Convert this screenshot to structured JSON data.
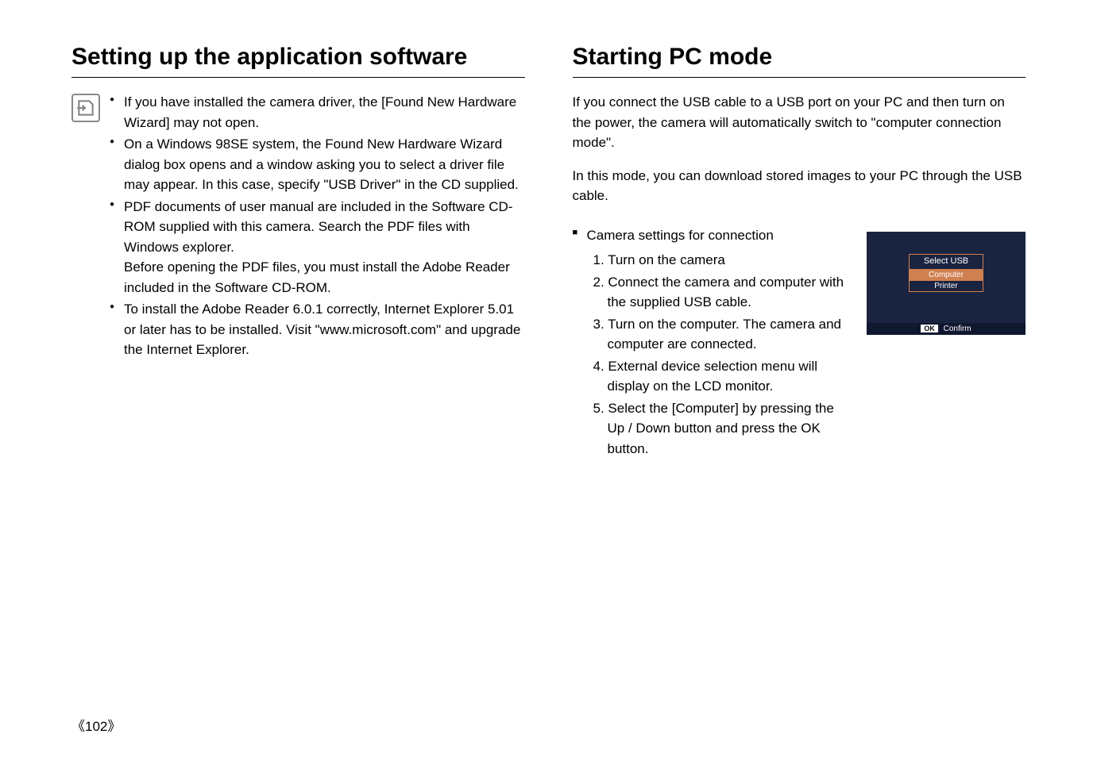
{
  "left": {
    "title": "Setting up the application software",
    "bullets": [
      {
        "text": "If you have installed the camera driver, the [Found New Hardware Wizard] may not open."
      },
      {
        "text": "On a Windows 98SE system, the Found New Hardware Wizard dialog box opens and a window asking you to select a driver file may appear. In this case, specify \"USB Driver\" in the CD supplied."
      },
      {
        "text": "PDF documents of user manual are included in the Software CD-ROM supplied with this camera. Search the PDF files with Windows explorer.",
        "subtext": "Before opening the PDF files, you must install the Adobe Reader included in the Software CD-ROM."
      },
      {
        "text": "To install the Adobe Reader 6.0.1 correctly, Internet Explorer 5.01 or later has to be installed. Visit \"www.microsoft.com\" and upgrade the Internet Explorer."
      }
    ]
  },
  "right": {
    "title": "Starting PC mode",
    "intro1": "If you connect the USB cable to a USB port on your PC and then turn on the power, the camera will automatically switch to \"computer connection mode\".",
    "intro2": "In this mode, you can download stored images to your PC through the USB cable.",
    "settings_header": "Camera settings for connection",
    "steps": [
      "1. Turn on the camera",
      "2. Connect the camera and computer with the supplied USB cable.",
      "3. Turn on the computer. The camera and computer are connected.",
      "4. External device selection menu will display on the LCD monitor.",
      "5. Select the [Computer] by pressing the Up / Down button and press the OK button."
    ],
    "lcd": {
      "title": "Select USB",
      "option_computer": "Computer",
      "option_printer": "Printer",
      "ok_label": "OK",
      "confirm_label": "Confirm"
    }
  },
  "page_number": "102"
}
